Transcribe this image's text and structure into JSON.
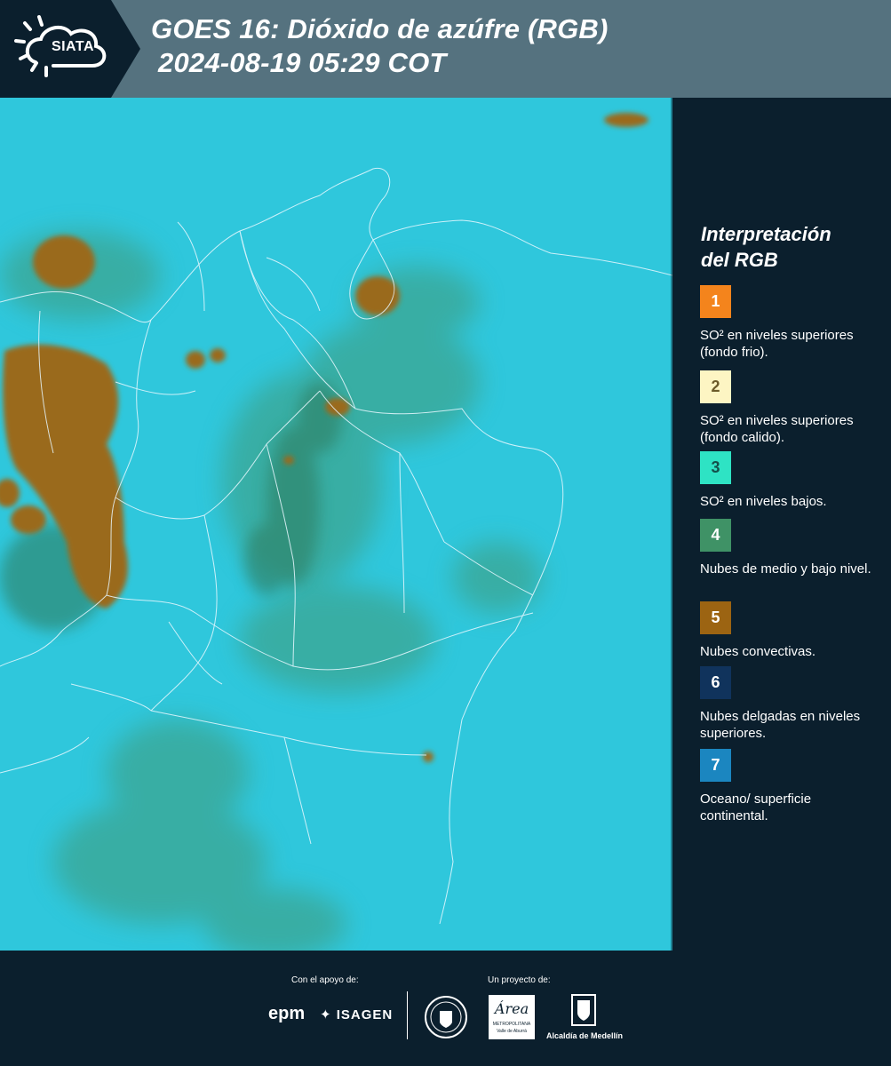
{
  "header": {
    "logo_text": "SIATA",
    "title_line1": "GOES 16: Dióxido de azúfre (RGB)",
    "title_line2": "2024-08-19 05:29 COT"
  },
  "legend": {
    "title_line1": "Interpretación",
    "title_line2": "del RGB",
    "items": [
      {
        "number": "1",
        "color": "#f4841c",
        "text_color": "#ffffff",
        "text": "SO² en niveles superiores (fondo frio)."
      },
      {
        "number": "2",
        "color": "#fdf5c3",
        "text_color": "#6b5a2a",
        "text": "SO² en niveles superiores (fondo calido)."
      },
      {
        "number": "3",
        "color": "#2ee3c4",
        "text_color": "#14504a",
        "text": "SO² en niveles bajos."
      },
      {
        "number": "4",
        "color": "#3f9266",
        "text_color": "#ffffff",
        "text": "Nubes de medio y bajo nivel."
      },
      {
        "number": "5",
        "color": "#9c6412",
        "text_color": "#ffffff",
        "text": "Nubes convectivas."
      },
      {
        "number": "6",
        "color": "#10335c",
        "text_color": "#ffffff",
        "text": "Nubes delgadas en niveles superiores."
      },
      {
        "number": "7",
        "color": "#1b86c0",
        "text_color": "#ffffff",
        "text": "Oceano/ superficie continental."
      }
    ]
  },
  "footer": {
    "support_label": "Con el apoyo de:",
    "project_label": "Un proyecto de:",
    "sponsor_epm": "epm",
    "sponsor_isagen": "ISAGEN",
    "sponsor_metro_name": "Área",
    "sponsor_metro_sub1": "METROPOLITANA",
    "sponsor_metro_sub2": "Valle de Aburrá",
    "sponsor_alcaldia": "Alcaldía de Medellín"
  },
  "colors": {
    "header_bg": "#55727f",
    "panel_bg": "#0b1f2d",
    "ocean": "#2ec8dc",
    "convective": "#9c6412",
    "mid_low_cloud": "#3f9266"
  }
}
